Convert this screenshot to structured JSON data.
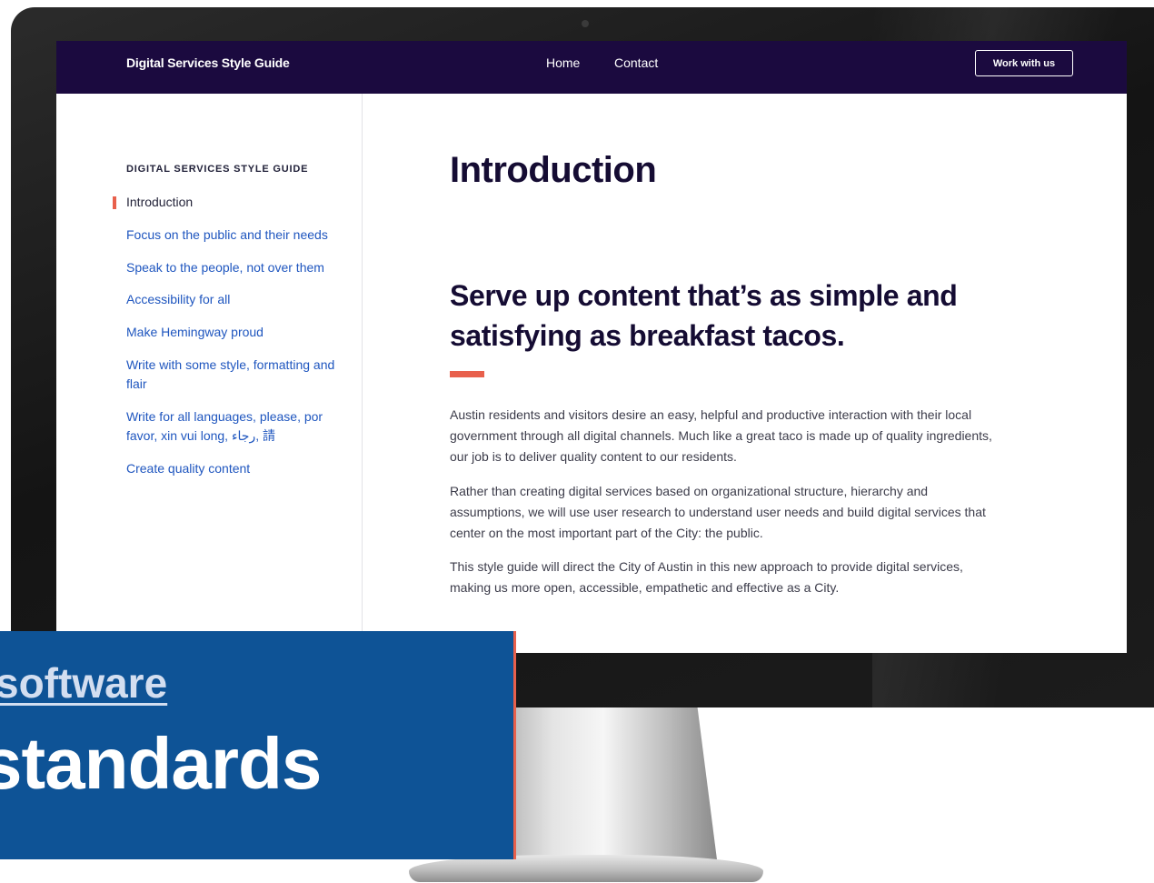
{
  "site": {
    "title": "Digital Services Style Guide",
    "nav": {
      "home": "Home",
      "contact": "Contact"
    },
    "cta": "Work with us"
  },
  "sidebar": {
    "heading": "DIGITAL SERVICES STYLE GUIDE",
    "items": [
      {
        "label": "Introduction",
        "active": true
      },
      {
        "label": "Focus on the public and their needs"
      },
      {
        "label": "Speak to the people, not over them"
      },
      {
        "label": "Accessibility for all"
      },
      {
        "label": "Make Hemingway proud"
      },
      {
        "label": "Write with some style, formatting and flair"
      },
      {
        "label": "Write for all languages, please, por favor, xin vui long, رجاء, 請"
      },
      {
        "label": "Create quality content"
      }
    ]
  },
  "main": {
    "title": "Introduction",
    "tagline": "Serve up content that’s as simple and satisfying as breakfast tacos.",
    "paragraphs": [
      "Austin residents and visitors desire an easy, helpful and productive interaction with their local government through all digital channels. Much like a great taco is made up of quality ingredients, our job is to deliver quality content to our residents.",
      "Rather than creating digital services based on organizational structure, hierarchy and assumptions, we will use user research to understand user needs and build digital services that center on the most important part of the City: the public.",
      "This style guide will direct the City of Austin in this new approach to provide digital services, making us more open, accessible, empathetic and effective as a City."
    ]
  },
  "banner": {
    "link": "software",
    "heading": "standards"
  },
  "colors": {
    "header_bg": "#1b0a3f",
    "link": "#1f56bf",
    "accent": "#e8604c",
    "banner_bg": "#0e5396"
  }
}
